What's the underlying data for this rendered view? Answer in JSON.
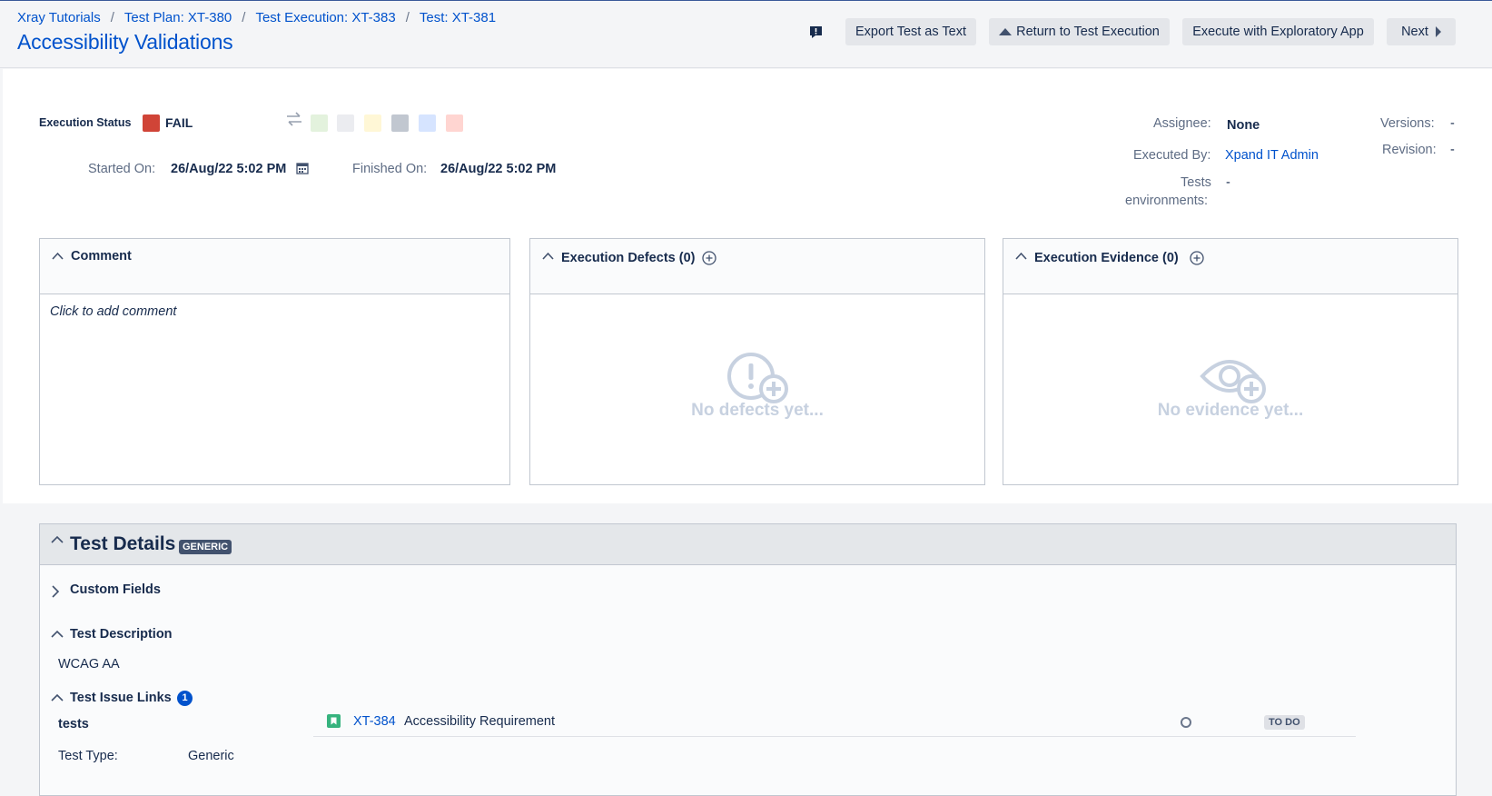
{
  "breadcrumb": {
    "items": [
      "Xray Tutorials",
      "Test Plan: XT-380",
      "Test Execution: XT-383",
      "Test: XT-381"
    ],
    "separator": "/"
  },
  "page": {
    "title": "Accessibility Validations"
  },
  "toolbar": {
    "feedback_icon": "feedback-icon",
    "export_label": "Export Test as Text",
    "return_label": "Return to Test Execution",
    "exploratory_label": "Execute with Exploratory App",
    "next_label": "Next"
  },
  "execution": {
    "status_label": "Execution Status",
    "status_value": "FAIL",
    "status_color": "#d04437",
    "status_options": [
      "#e3f2dd",
      "#ebecf0",
      "#fff7d6",
      "#c1c7d0",
      "#d6e4ff",
      "#ffd5d1"
    ],
    "started_label": "Started On:",
    "started_value": "26/Aug/22 5:02 PM",
    "finished_label": "Finished On:",
    "finished_value": "26/Aug/22 5:02 PM"
  },
  "meta": {
    "assignee_label": "Assignee:",
    "assignee_value": "None",
    "executed_by_label": "Executed By:",
    "executed_by_value": "Xpand IT Admin",
    "tests_env_label_1": "Tests",
    "tests_env_label_2": "environments:",
    "tests_env_value": "-",
    "versions_label": "Versions:",
    "versions_value": "-",
    "revision_label": "Revision:",
    "revision_value": "-"
  },
  "panels": {
    "comment": {
      "title": "Comment",
      "placeholder": "Click to add comment"
    },
    "defects": {
      "title": "Execution Defects (0)",
      "empty": "No defects yet..."
    },
    "evidence": {
      "title": "Execution Evidence (0)",
      "empty": "No evidence yet..."
    }
  },
  "details": {
    "title": "Test Details",
    "badge": "GENERIC",
    "custom_fields": "Custom Fields",
    "description_title": "Test Description",
    "description_text": "WCAG AA",
    "links_title": "Test Issue Links",
    "links_count": "1",
    "links": [
      {
        "relation": "tests",
        "key": "XT-384",
        "summary": "Accessibility Requirement",
        "status": "TO DO"
      }
    ],
    "test_type_label": "Test Type:",
    "test_type_value": "Generic"
  },
  "colors": {
    "accent": "#0052cc",
    "fail": "#d04437",
    "story": "#36b37e"
  }
}
